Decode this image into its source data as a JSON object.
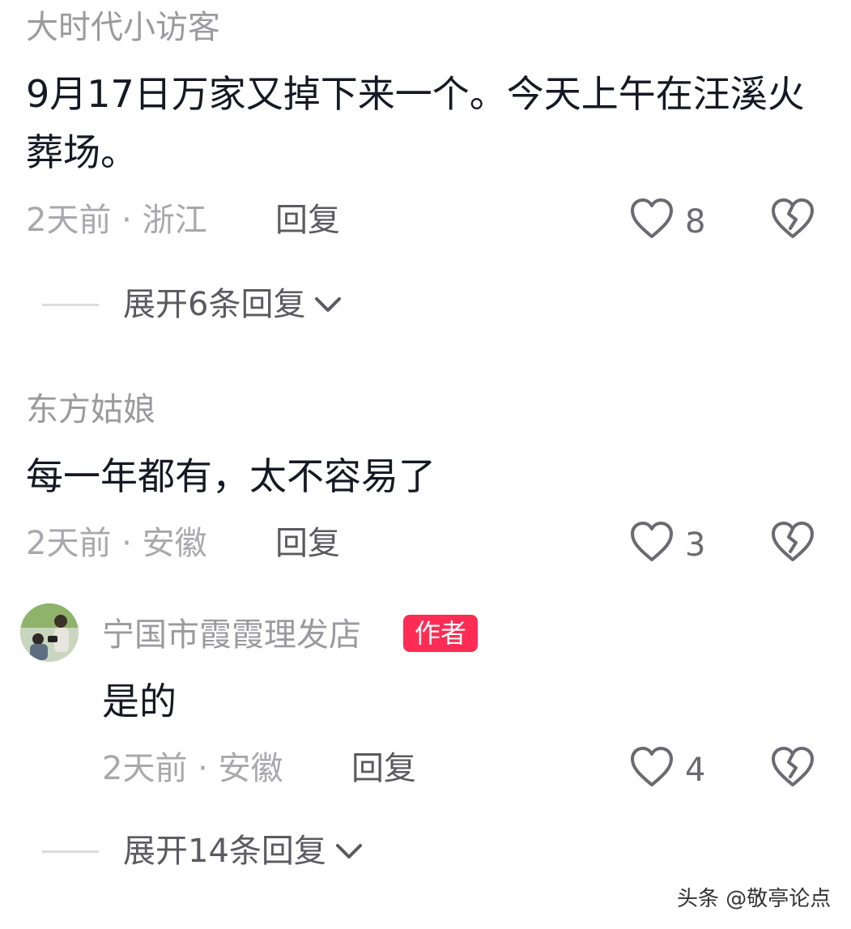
{
  "comments": [
    {
      "username": "大时代小访客",
      "content": "9月17日万家又掉下来一个。今天上午在汪溪火葬场。",
      "meta": "2天前 · 浙江",
      "reply_label": "回复",
      "likes": "8",
      "expand_label": "展开6条回复"
    },
    {
      "username": "东方姑娘",
      "content": "每一年都有，太不容易了",
      "meta": "2天前 · 安徽",
      "reply_label": "回复",
      "likes": "3"
    }
  ],
  "author_reply": {
    "username": "宁国市霞霞理发店",
    "badge": "作者",
    "content": "是的",
    "meta": "2天前 · 安徽",
    "reply_label": "回复",
    "likes": "4",
    "expand_label": "展开14条回复"
  },
  "watermark": "头条 @敬亭论点",
  "colors": {
    "text_primary": "#161823",
    "text_secondary": "#9a9a9f",
    "badge_bg": "#fe2c55",
    "divider": "#dcdcde"
  },
  "icons": {
    "like": "heart-outline-icon",
    "dislike": "broken-heart-icon",
    "expand": "chevron-down-icon"
  }
}
